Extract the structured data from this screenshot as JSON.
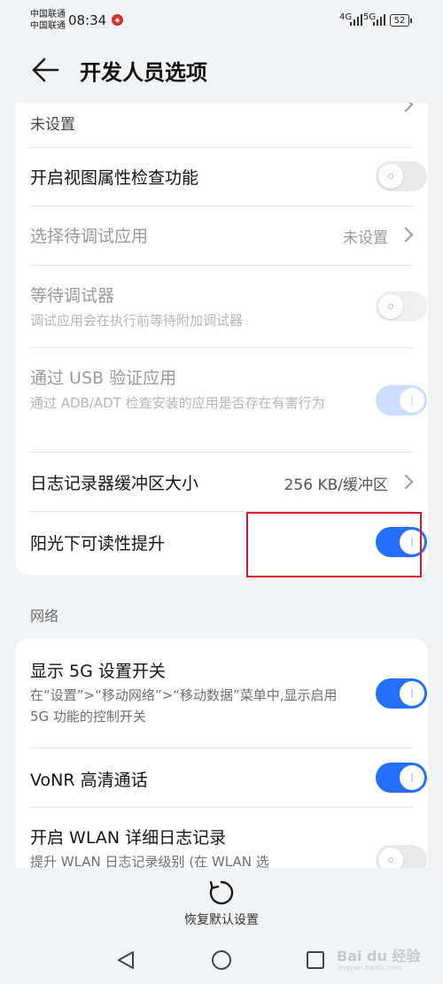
{
  "status_bar": {
    "carrier_1": "中国联通",
    "carrier_2": "中国联通",
    "time": "08:34",
    "net_1": "4G",
    "net_2": "5G",
    "battery": "52"
  },
  "header": {
    "title": "开发人员选项"
  },
  "settings": {
    "truncated_row_value": "未设置",
    "view_attr_check": {
      "title": "开启视图属性检查功能",
      "toggle_on": false
    },
    "debug_app": {
      "title": "选择待调试应用",
      "value": "未设置"
    },
    "wait_debugger": {
      "title": "等待调试器",
      "subtitle": "调试应用会在执行前等待附加调试器",
      "toggle_on": false
    },
    "usb_verify": {
      "title": "通过 USB 验证应用",
      "subtitle": "通过 ADB/ADT 检查安装的应用是否存在有害行为",
      "toggle_on": true
    },
    "log_buffer": {
      "title": "日志记录器缓冲区大小",
      "value": "256 KB/缓冲区"
    },
    "sunlight": {
      "title": "阳光下可读性提升",
      "toggle_on": true
    }
  },
  "network_section": {
    "header": "网络",
    "show_5g": {
      "title": "显示 5G 设置开关",
      "subtitle": "在“设置”>“移动网络”>“移动数据”菜单中,显示启用 5G 功能的控制开关",
      "toggle_on": true
    },
    "vonr": {
      "title": "VoNR 高清通话",
      "toggle_on": true
    },
    "wlan_log": {
      "title": "开启 WLAN 详细日志记录",
      "subtitle": "提升 WLAN 日志记录级别 (在 WLAN 选",
      "toggle_on": false
    }
  },
  "bottom": {
    "reset_label": "恢复默认设置"
  },
  "watermark": {
    "text": "Bai du 经验",
    "sub": "jingyan.baidu.com"
  },
  "colors": {
    "accent": "#256fff",
    "highlight": "#d8192d",
    "background": "#f1f3f5"
  },
  "icons": [
    "back-arrow-icon",
    "chevron-right-icon",
    "reset-icon",
    "nav-back-icon",
    "nav-home-icon",
    "nav-recents-icon"
  ]
}
